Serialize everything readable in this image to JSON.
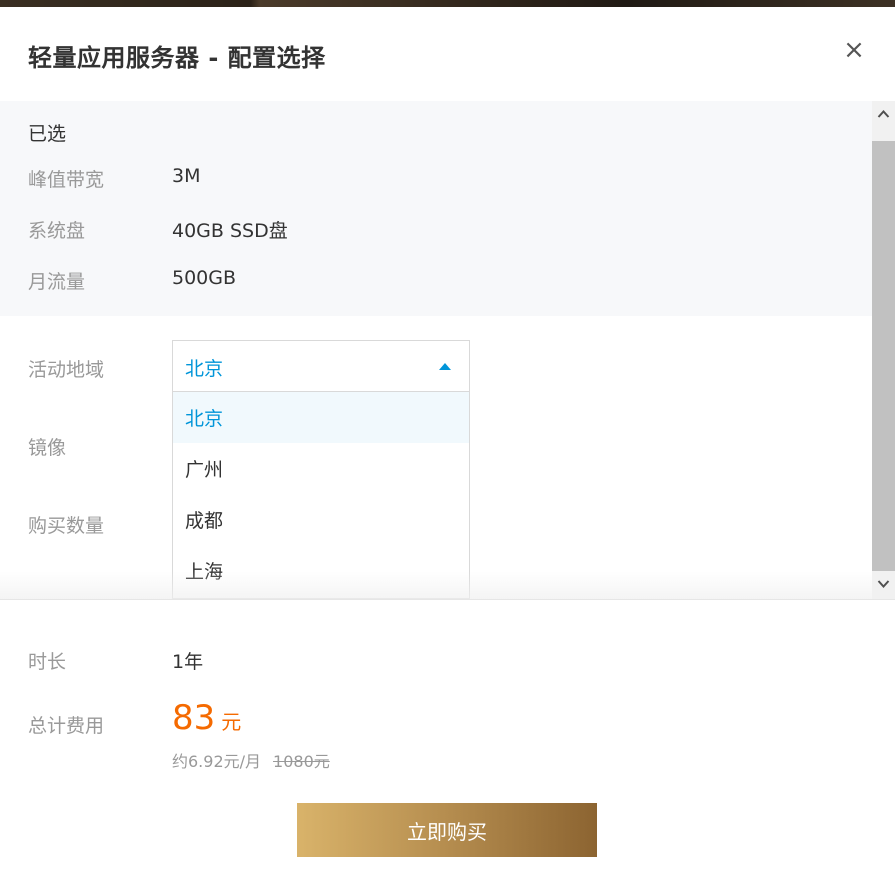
{
  "dialog": {
    "title": "轻量应用服务器 - 配置选择",
    "close_label": "×"
  },
  "selected": {
    "heading": "已选",
    "rows": [
      {
        "label": "峰值带宽",
        "value": "3M"
      },
      {
        "label": "系统盘",
        "value": "40GB SSD盘"
      },
      {
        "label": "月流量",
        "value": "500GB"
      }
    ]
  },
  "form": {
    "region_label": "活动地域",
    "image_label": "镜像",
    "quantity_label": "购买数量",
    "region_selected": "北京",
    "region_options": [
      "北京",
      "广州",
      "成都",
      "上海"
    ],
    "active_index": 0
  },
  "footer": {
    "duration_label": "时长",
    "duration_value": "1年",
    "total_label": "总计费用",
    "price": "83",
    "price_unit": "元",
    "monthly": "约6.92元/月",
    "original_price": "1080元",
    "buy_label": "立即购买"
  },
  "icons": {
    "close": "close-icon",
    "dropdown": "caret-up-icon",
    "scroll_up": "chevron-up-icon",
    "scroll_down": "chevron-down-icon"
  },
  "colors": {
    "accent": "#0095d9",
    "price": "#f56a00",
    "button_start": "#d9b36a",
    "button_end": "#8c6431"
  }
}
